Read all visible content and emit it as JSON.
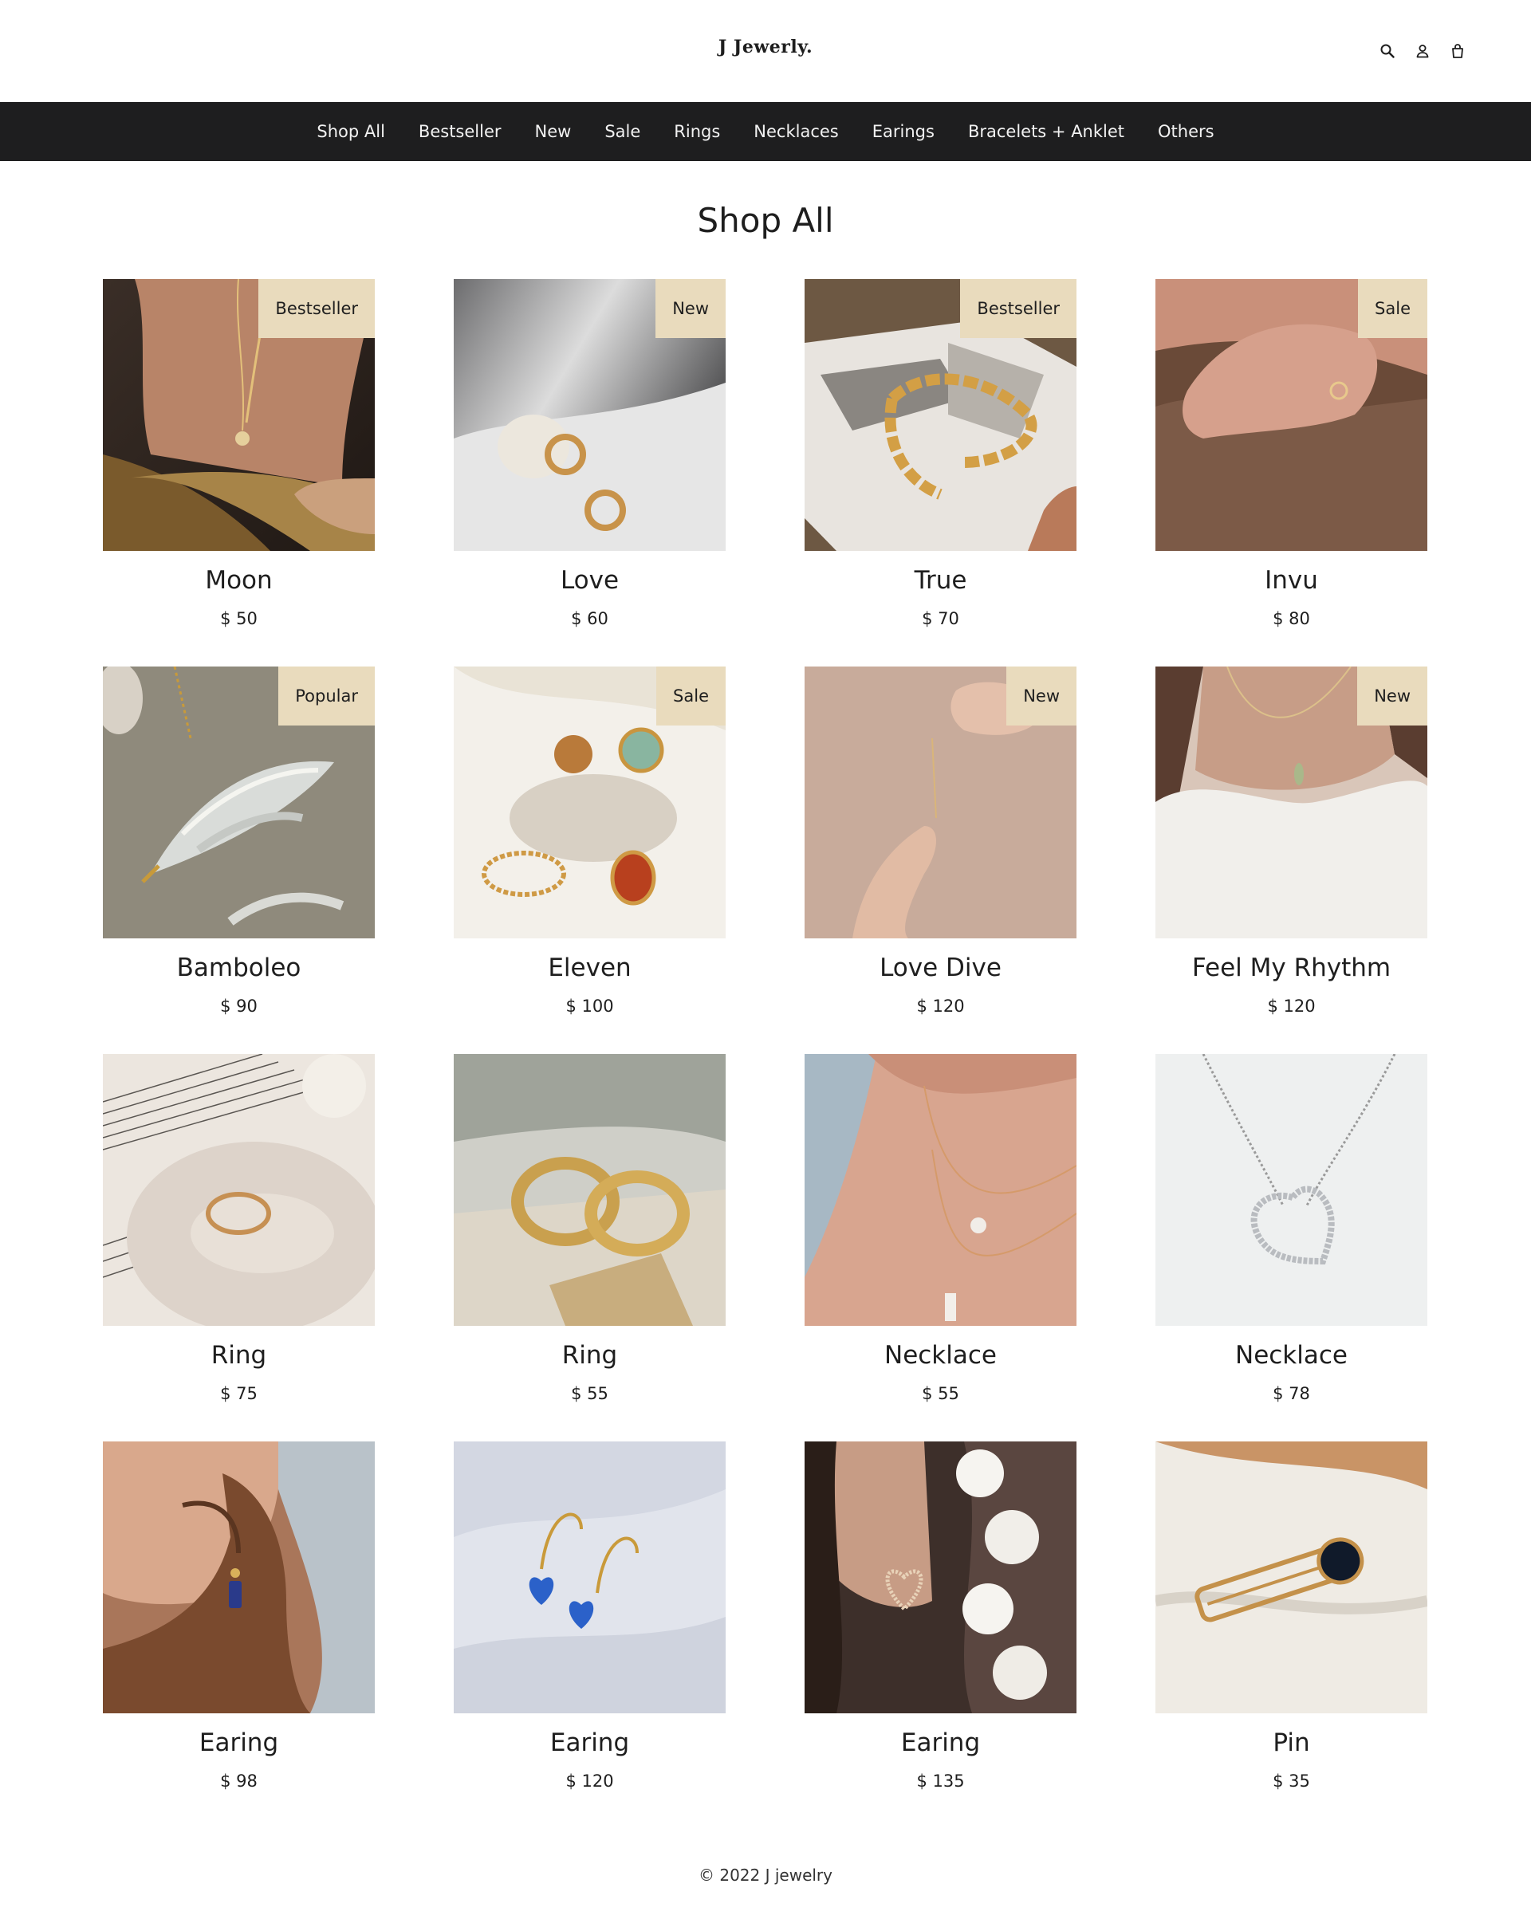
{
  "store": {
    "logo": "J Jewerly."
  },
  "header_icons": [
    "search-icon",
    "account-icon",
    "cart-icon"
  ],
  "nav": [
    "Shop All",
    "Bestseller",
    "New",
    "Sale",
    "Rings",
    "Necklaces",
    "Earings",
    "Bracelets + Anklet",
    "Others"
  ],
  "page": {
    "title": "Shop All"
  },
  "colors": {
    "nav_bg": "#1e1e1f",
    "badge_bg": "#e9dbbd",
    "text": "#1e1e1e"
  },
  "products": [
    {
      "name": "Moon",
      "price": "$ 50",
      "badge": "Bestseller"
    },
    {
      "name": "Love",
      "price": "$ 60",
      "badge": "New"
    },
    {
      "name": "True",
      "price": "$ 70",
      "badge": "Bestseller"
    },
    {
      "name": "Invu",
      "price": "$ 80",
      "badge": "Sale"
    },
    {
      "name": "Bamboleo",
      "price": "$ 90",
      "badge": "Popular"
    },
    {
      "name": "Eleven",
      "price": "$ 100",
      "badge": "Sale"
    },
    {
      "name": "Love Dive",
      "price": "$ 120",
      "badge": "New"
    },
    {
      "name": "Feel My Rhythm",
      "price": "$ 120",
      "badge": "New"
    },
    {
      "name": "Ring",
      "price": "$ 75",
      "badge": ""
    },
    {
      "name": "Ring",
      "price": "$ 55",
      "badge": ""
    },
    {
      "name": "Necklace",
      "price": "$ 55",
      "badge": ""
    },
    {
      "name": "Necklace",
      "price": "$ 78",
      "badge": ""
    },
    {
      "name": "Earing",
      "price": "$ 98",
      "badge": ""
    },
    {
      "name": "Earing",
      "price": "$ 120",
      "badge": ""
    },
    {
      "name": "Earing",
      "price": "$ 135",
      "badge": ""
    },
    {
      "name": "Pin",
      "price": "$ 35",
      "badge": ""
    }
  ],
  "footer": {
    "copyright": "© 2022 J jewelry"
  }
}
